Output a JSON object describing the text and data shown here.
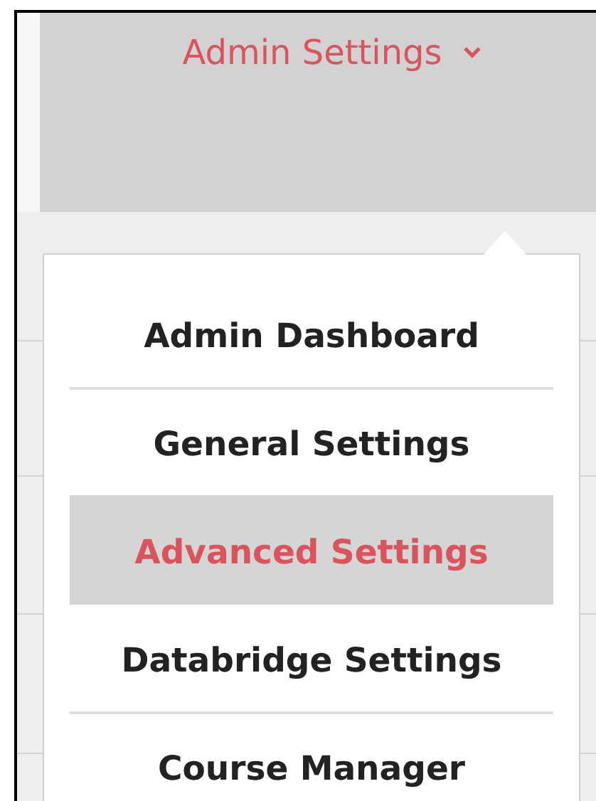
{
  "header": {
    "title": "Admin Settings",
    "expanded": true
  },
  "menu": [
    {
      "label": "Admin Dashboard",
      "selected": false
    },
    {
      "label": "General Settings",
      "selected": false
    },
    {
      "label": "Advanced Settings",
      "selected": true
    },
    {
      "label": "Databridge Settings",
      "selected": false
    },
    {
      "label": "Course Manager",
      "selected": false
    }
  ]
}
